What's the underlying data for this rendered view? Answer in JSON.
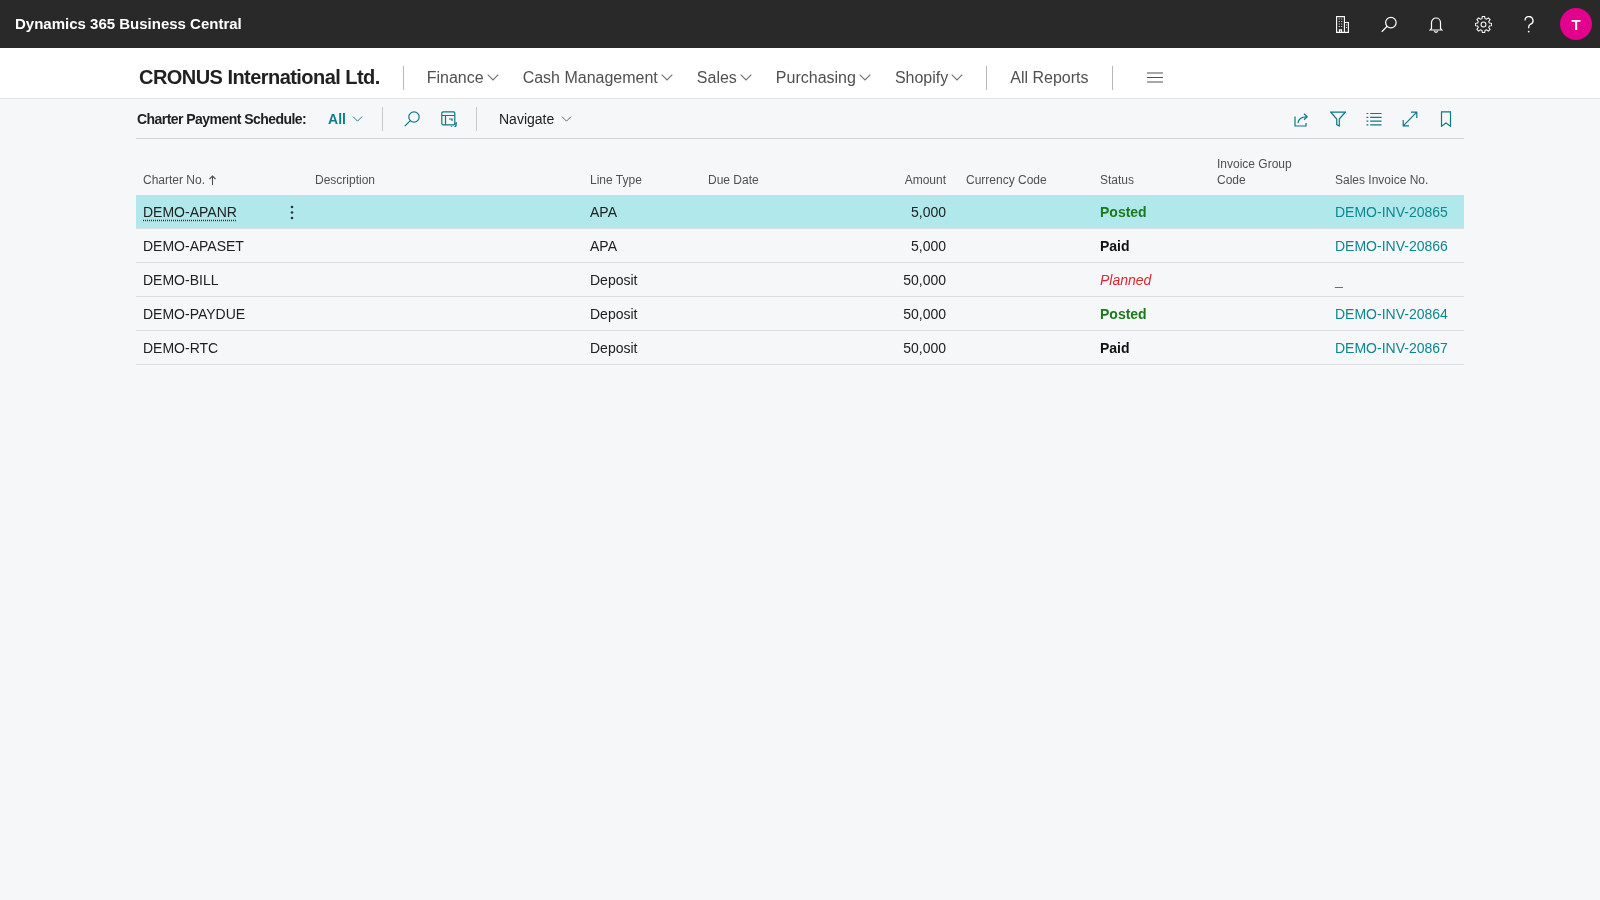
{
  "app_bar": {
    "title": "Dynamics 365 Business Central",
    "avatar_initial": "T"
  },
  "nav": {
    "company": "CRONUS International Ltd.",
    "menus": [
      {
        "label": "Finance"
      },
      {
        "label": "Cash Management"
      },
      {
        "label": "Sales"
      },
      {
        "label": "Purchasing"
      },
      {
        "label": "Shopify"
      }
    ],
    "reports": "All Reports"
  },
  "toolbar": {
    "page_title": "Charter Payment Schedule:",
    "view": "All",
    "navigate": "Navigate"
  },
  "table": {
    "columns": [
      {
        "label": "Charter No.",
        "kind": "text",
        "sorted": true
      },
      {
        "label": "Description",
        "kind": "text",
        "sorted": false
      },
      {
        "label": "Line Type",
        "kind": "text",
        "sorted": false
      },
      {
        "label": "Due Date",
        "kind": "text",
        "sorted": false
      },
      {
        "label": "Amount",
        "kind": "number",
        "sorted": false
      },
      {
        "label": "Currency Code",
        "kind": "text",
        "sorted": false
      },
      {
        "label": "Status",
        "kind": "text",
        "sorted": false
      },
      {
        "label": "Invoice Group Code",
        "kind": "text",
        "sorted": false
      },
      {
        "label": "Sales Invoice No.",
        "kind": "text",
        "sorted": false
      }
    ],
    "rows": [
      {
        "selected": true,
        "charter_no": "DEMO-APANR",
        "line_type": "APA",
        "amount": "5,000",
        "status": {
          "text": "Posted",
          "kind": "favorable"
        },
        "sales_invoice_no": "DEMO-INV-20865"
      },
      {
        "selected": false,
        "charter_no": "DEMO-APASET",
        "line_type": "APA",
        "amount": "5,000",
        "status": {
          "text": "Paid",
          "kind": "strong"
        },
        "sales_invoice_no": "DEMO-INV-20866"
      },
      {
        "selected": false,
        "charter_no": "DEMO-BILL",
        "line_type": "Deposit",
        "amount": "50,000",
        "status": {
          "text": "Planned",
          "kind": "attention"
        },
        "sales_invoice_no": "_"
      },
      {
        "selected": false,
        "charter_no": "DEMO-PAYDUE",
        "line_type": "Deposit",
        "amount": "50,000",
        "status": {
          "text": "Posted",
          "kind": "favorable"
        },
        "sales_invoice_no": "DEMO-INV-20864"
      },
      {
        "selected": false,
        "charter_no": "DEMO-RTC",
        "line_type": "Deposit",
        "amount": "50,000",
        "status": {
          "text": "Paid",
          "kind": "strong"
        },
        "sales_invoice_no": "DEMO-INV-20867"
      }
    ]
  }
}
